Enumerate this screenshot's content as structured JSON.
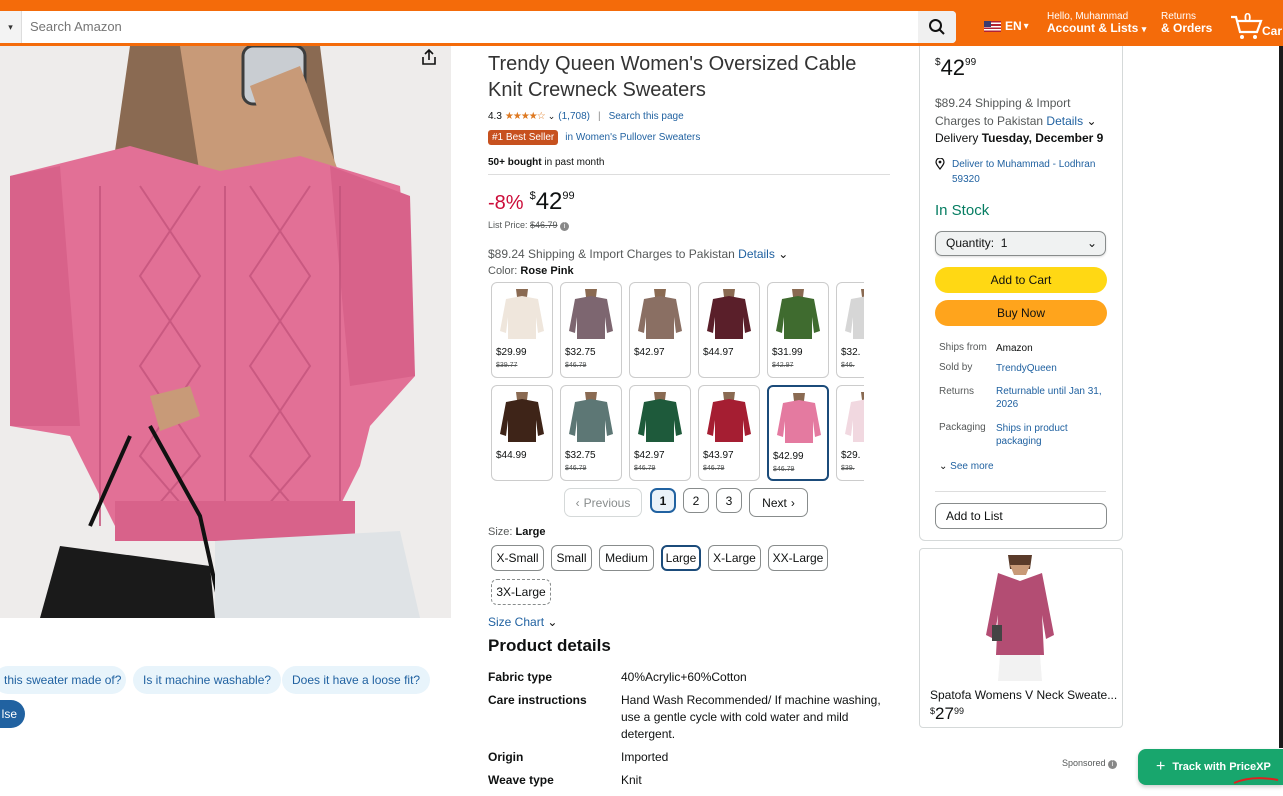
{
  "header": {
    "search_placeholder": "Search Amazon",
    "lang": "EN",
    "greeting": "Hello, Muhammad",
    "account": "Account & Lists",
    "returns_top": "Returns",
    "orders": "& Orders",
    "cart_count": "0",
    "cart_label": "Car"
  },
  "product": {
    "title_line1": "Trendy Queen Women's Oversized Cable",
    "title_line2": "Knit Crewneck Sweaters",
    "rating": "4.3",
    "rating_count": "(1,708)",
    "search_page": "Search this page",
    "best_seller_badge": "#1 Best Seller",
    "best_seller_category": "in Women's Pullover Sweaters",
    "bought": "50+ bought",
    "bought_suffix": "in past month",
    "discount": "-8%",
    "price_symbol": "$",
    "price_whole": "42",
    "price_fraction": "99",
    "list_price_label": "List Price:",
    "list_price": "$46.79",
    "shipping": "$89.24 Shipping & Import Charges to Pakistan",
    "details": "Details",
    "color_label": "Color:",
    "color_value": "Rose Pink",
    "size_label": "Size:",
    "size_value": "Large",
    "size_chart": "Size Chart"
  },
  "swatches": [
    {
      "price": "$29.99",
      "list": "$39.77",
      "color": "#efe6dc"
    },
    {
      "price": "$32.75",
      "list": "$46.79",
      "color": "#7d6670"
    },
    {
      "price": "$42.97",
      "list": "",
      "color": "#8a6f63"
    },
    {
      "price": "$44.97",
      "list": "",
      "color": "#5a1f2a"
    },
    {
      "price": "$31.99",
      "list": "$42.97",
      "color": "#3f6b2f"
    },
    {
      "price": "$32.",
      "list": "$46.",
      "color": "#d6d6d6"
    },
    {
      "price": "$44.99",
      "list": "",
      "color": "#3e2418"
    },
    {
      "price": "$32.75",
      "list": "$46.79",
      "color": "#5d7775"
    },
    {
      "price": "$42.97",
      "list": "$46.79",
      "color": "#1e5a3b"
    },
    {
      "price": "$43.97",
      "list": "$46.79",
      "color": "#a51e32"
    },
    {
      "price": "$42.99",
      "list": "$46.79",
      "color": "#e47aa0"
    },
    {
      "price": "$29.",
      "list": "$39.",
      "color": "#f1d8e0"
    }
  ],
  "pagination": {
    "previous": "Previous",
    "p1": "1",
    "p2": "2",
    "p3": "3",
    "next": "Next"
  },
  "sizes": [
    "X-Small",
    "Small",
    "Medium",
    "Large",
    "X-Large",
    "XX-Large",
    "3X-Large"
  ],
  "questions": [
    "this sweater made of?",
    "Is it machine washable?",
    "Does it have a loose fit?",
    "lse"
  ],
  "details_section": {
    "heading": "Product details",
    "rows": [
      {
        "label": "Fabric type",
        "value": "40%Acrylic+60%Cotton"
      },
      {
        "label": "Care instructions",
        "value": "Hand Wash Recommended/ If machine washing, use a gentle cycle with cold water and mild detergent."
      },
      {
        "label": "Origin",
        "value": "Imported"
      },
      {
        "label": "Weave type",
        "value": "Knit"
      }
    ]
  },
  "buybox": {
    "price_symbol": "$",
    "price_whole": "42",
    "price_fraction": "99",
    "shipping_line1": "$89.24 Shipping & Import",
    "shipping_line2": "Charges to Pakistan",
    "details": "Details",
    "delivery_prefix": "Delivery",
    "delivery_date": "Tuesday, December 9",
    "deliver_to_line1": "Deliver to Muhammad - Lodhran",
    "deliver_to_line2": "59320",
    "stock": "In Stock",
    "quantity": "Quantity:  1",
    "add_to_cart": "Add to Cart",
    "buy_now": "Buy Now",
    "ships_from_label": "Ships from",
    "ships_from": "Amazon",
    "sold_by_label": "Sold by",
    "sold_by": "TrendyQueen",
    "returns_label": "Returns",
    "returns": "Returnable until Jan 31, 2026",
    "packaging_label": "Packaging",
    "packaging": "Ships in product packaging",
    "see_more": "See more",
    "add_to_list": "Add to List"
  },
  "ad": {
    "title": "Spatofa Womens V Neck Sweate...",
    "price_symbol": "$",
    "price_whole": "27",
    "price_fraction": "99",
    "sponsored": "Sponsored"
  },
  "extension": {
    "label": "Track with PriceXP"
  },
  "colors": {
    "nav": "#f46b0a",
    "link": "#2162a1",
    "add_to_cart": "#ffd814",
    "buy_now": "#ffa41c",
    "in_stock": "#067d62",
    "deal": "#cc0c39",
    "badge": "#c7511f",
    "pricexp": "#18a66d"
  }
}
